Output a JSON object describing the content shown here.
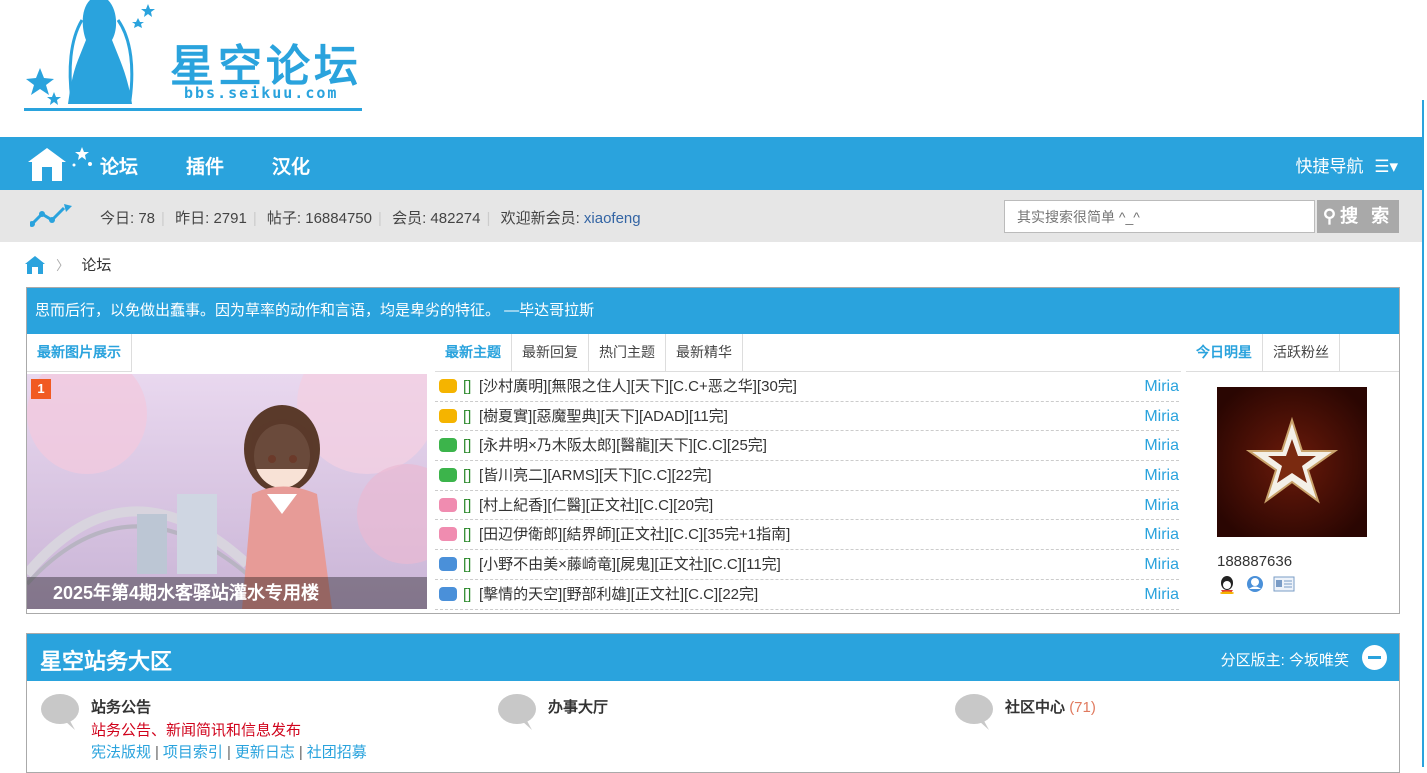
{
  "logo": {
    "title": "星空论坛",
    "url": "bbs.seikuu.com"
  },
  "nav": {
    "items": [
      "论坛",
      "插件",
      "汉化"
    ],
    "quick_nav": "快捷导航"
  },
  "stats": {
    "today_label": "今日:",
    "today": "78",
    "yesterday_label": "昨日:",
    "yesterday": "2791",
    "posts_label": "帖子:",
    "posts": "16884750",
    "members_label": "会员:",
    "members": "482274",
    "welcome_label": "欢迎新会员:",
    "newest_member": "xiaofeng"
  },
  "search": {
    "placeholder": "其实搜索很简单 ^_^",
    "button": "搜 索"
  },
  "breadcrumb": {
    "current": "论坛"
  },
  "quote": "思而后行，以免做出蠢事。因为草率的动作和言语，均是卑劣的特征。 —毕达哥拉斯",
  "left_panel": {
    "tab": "最新图片展示",
    "slide_number": "1",
    "caption": "2025年第4期水客驿站灌水专用楼"
  },
  "mid_panel": {
    "tabs": [
      "最新主题",
      "最新回复",
      "热门主题",
      "最新精华"
    ],
    "threads": [
      {
        "bracket": "[]",
        "title": "[沙村廣明][無限之住人][天下][C.C+恶之华][30完]",
        "author": "Miria",
        "icon_color": "#f5b400"
      },
      {
        "bracket": "[]",
        "title": "[樹夏實][惡魔聖典][天下][ADAD][11完]",
        "author": "Miria",
        "icon_color": "#f5b400"
      },
      {
        "bracket": "[]",
        "title": "[永井明×乃木阪太郎][醫龍][天下][C.C][25完]",
        "author": "Miria",
        "icon_color": "#3cb44b"
      },
      {
        "bracket": "[]",
        "title": "[皆川亮二][ARMS][天下][C.C][22完]",
        "author": "Miria",
        "icon_color": "#3cb44b"
      },
      {
        "bracket": "[]",
        "title": "[村上紀香][仁醫][正文社][C.C][20完]",
        "author": "Miria",
        "icon_color": "#f08cb0"
      },
      {
        "bracket": "[]",
        "title": "[田辺伊衛郎][結界師][正文社][C.C][35完+1指南]",
        "author": "Miria",
        "icon_color": "#f08cb0"
      },
      {
        "bracket": "[]",
        "title": "[小野不由美×藤崎竜][屍鬼][正文社][C.C][11完]",
        "author": "Miria",
        "icon_color": "#4a90d9"
      },
      {
        "bracket": "[]",
        "title": "[擊情的天空][野部利雄][正文社][C.C][22完]",
        "author": "Miria",
        "icon_color": "#4a90d9"
      }
    ]
  },
  "right_panel": {
    "tabs": [
      "今日明星",
      "活跃粉丝"
    ],
    "star_name": "188887636"
  },
  "section": {
    "title": "星空站务大区",
    "moderator": "分区版主: 今坂唯笑",
    "forums": [
      {
        "name": "站务公告",
        "count": "",
        "desc": "站务公告、新闻简讯和信息发布",
        "links": [
          "宪法版规",
          "项目索引",
          "更新日志",
          "社团招募"
        ]
      },
      {
        "name": "办事大厅",
        "count": "",
        "desc": "",
        "links": []
      },
      {
        "name": "社区中心",
        "count": "(71)",
        "desc": "",
        "links": []
      }
    ]
  },
  "colors": {
    "brand": "#2aa3dd",
    "link": "#3465a4",
    "alert": "#d0021b"
  }
}
